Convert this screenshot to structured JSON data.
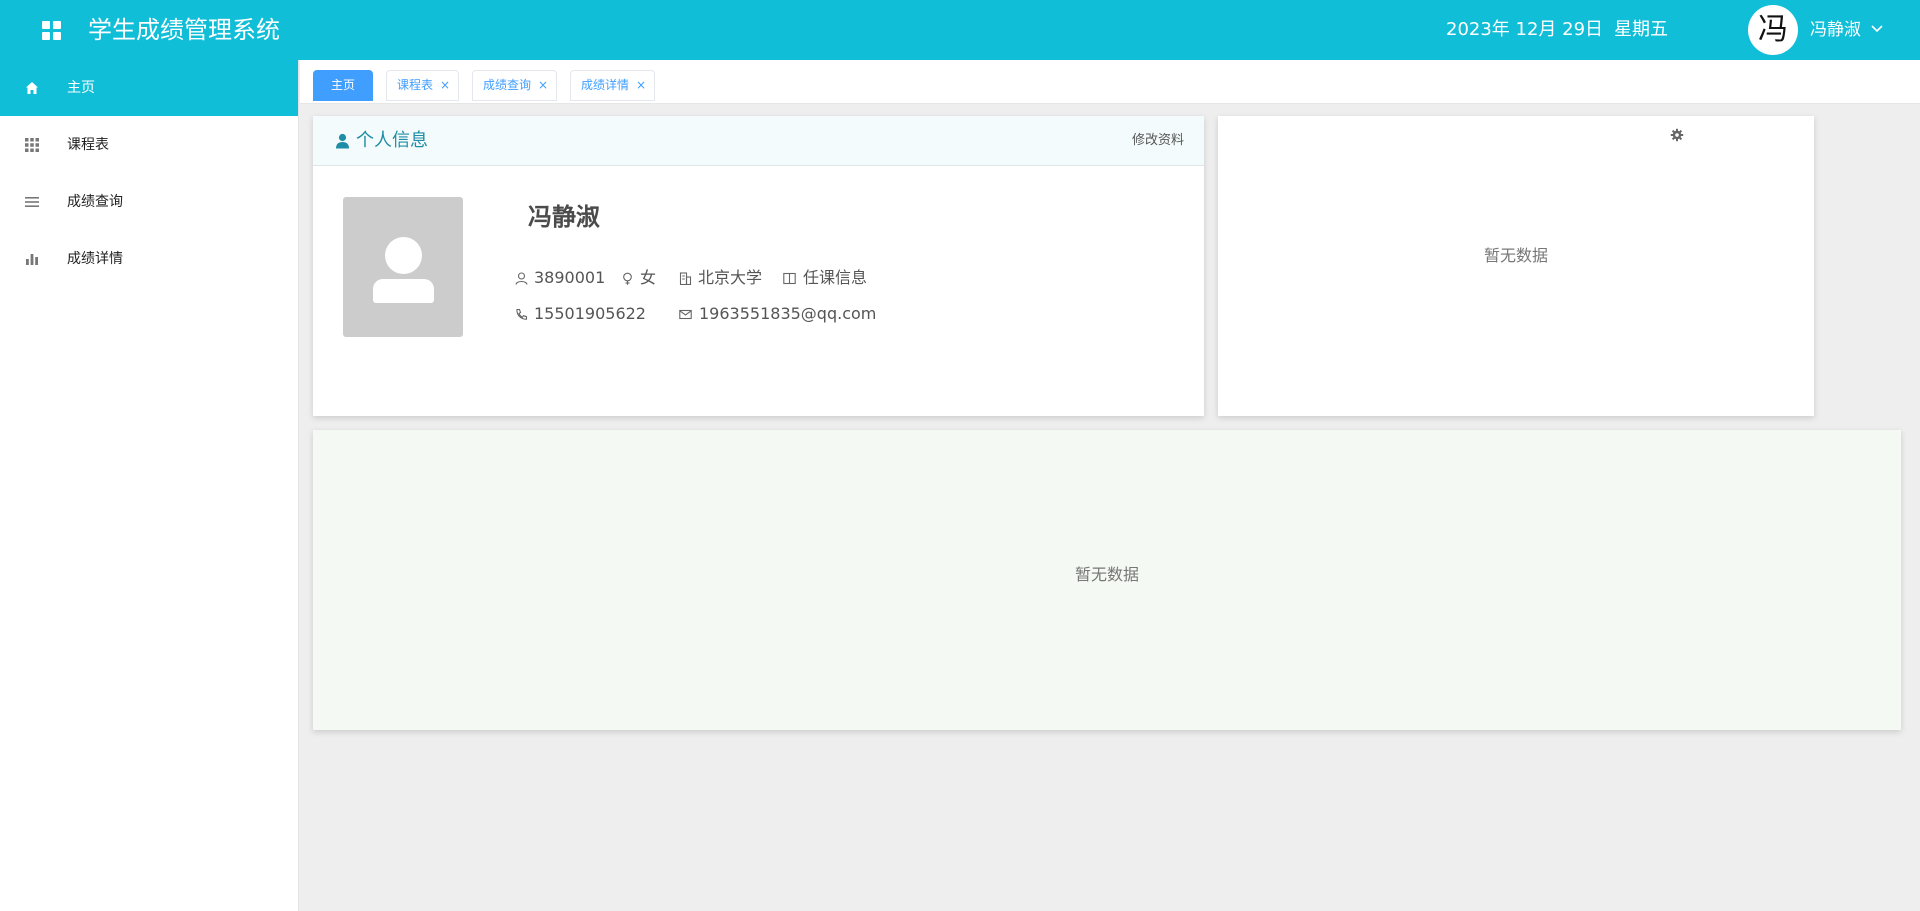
{
  "header": {
    "app_title": "学生成绩管理系统",
    "date": "2023年 12月 29日",
    "weekday": "星期五",
    "avatar_char": "冯",
    "user_name": "冯静淑",
    "logo_icon": "grid-apps-icon",
    "background": "#11bed8"
  },
  "sidebar": {
    "items": [
      {
        "label": "主页",
        "icon": "home-icon",
        "active": true
      },
      {
        "label": "课程表",
        "icon": "grid-icon",
        "active": false
      },
      {
        "label": "成绩查询",
        "icon": "list-icon",
        "active": false
      },
      {
        "label": "成绩详情",
        "icon": "bar-chart-icon",
        "active": false
      }
    ]
  },
  "tabs": [
    {
      "label": "主页",
      "active": true,
      "closable": false
    },
    {
      "label": "课程表",
      "active": false,
      "closable": true
    },
    {
      "label": "成绩查询",
      "active": false,
      "closable": true
    },
    {
      "label": "成绩详情",
      "active": false,
      "closable": true
    }
  ],
  "tab_close_glyph": "×",
  "profile": {
    "title": "个人信息",
    "edit_label": "修改资料",
    "name": "冯静淑",
    "student_id": "3890001",
    "gender": "女",
    "school": "北京大学",
    "course_info": "任课信息",
    "phone": "15501905622",
    "email": "1963551835@qq.com"
  },
  "side_panel": {
    "empty_text": "暂无数据"
  },
  "bottom_panel": {
    "empty_text": "暂无数据"
  },
  "colors": {
    "accent": "#11bed8",
    "tab_active": "#409eff",
    "title_blue": "#1e8da6"
  }
}
